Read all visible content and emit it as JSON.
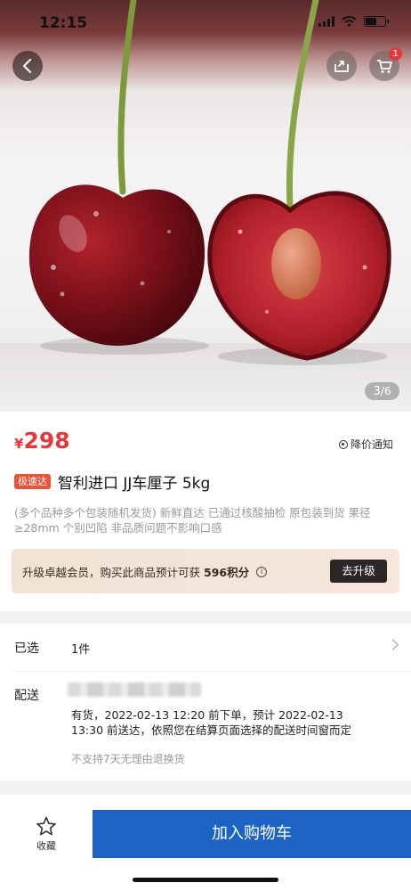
{
  "status_bar": {
    "time": "12:15"
  },
  "header": {
    "cart_count": "1"
  },
  "gallery": {
    "current": "3",
    "total": "/6"
  },
  "product": {
    "currency": "¥",
    "price": "298",
    "price_alert_label": "降价通知",
    "express_badge": "极速达",
    "title": "智利进口 JJ车厘子 5kg",
    "description": "(多个品种多个包装随机发货) 新鲜直达 已通过核酸抽检 原包装到货 果径≥28mm 个别凹陷 非品质问题不影响口感"
  },
  "vip_banner": {
    "text_prefix": "升级卓越会员，购买此商品预计可获",
    "points": "596积分",
    "info_glyph": "i",
    "button_label": "去升级"
  },
  "selection": {
    "selected_label": "已选",
    "selected_value": "1件",
    "delivery_label": "配送",
    "delivery_info": "有货，2022-02-13 12:20 前下单，预计 2022-02-13 13:30 前送达，依照您在结算页面选择的配送时间窗而定",
    "return_policy": "不支持7天无理由退换货"
  },
  "bottom_bar": {
    "favorite_label": "收藏",
    "add_to_cart_label": "加入购物车"
  },
  "colors": {
    "price_red": "#e4393c",
    "express_orange": "#e8533a",
    "cart_blue": "#1d63c6",
    "upgrade_dark": "#2a2726"
  },
  "icons": [
    "back-arrow-icon",
    "share-icon",
    "cart-icon",
    "price-alert-icon",
    "info-icon",
    "chevron-right-icon",
    "star-icon"
  ]
}
